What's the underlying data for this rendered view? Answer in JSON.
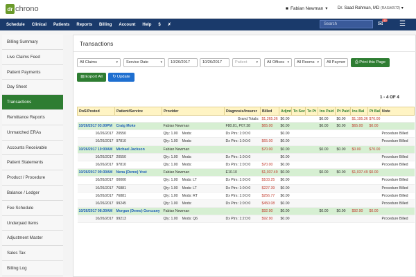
{
  "app": {
    "logo_dr": "dr",
    "logo_name": "chrono"
  },
  "header": {
    "user_name": "Fabian Newman",
    "doctor": "Dr. Saad Rahman, MD",
    "doctor_code": "(RASA6572)"
  },
  "nav": {
    "items": [
      "Schedule",
      "Clinical",
      "Patients",
      "Reports",
      "Billing",
      "Account",
      "Help"
    ],
    "search_placeholder": "Search",
    "mail_badge": "40"
  },
  "sidebar": {
    "items": [
      "Billing Summary",
      "Live Claims Feed",
      "Patient Payments",
      "Day Sheet",
      "Transactions",
      "Remittance Reports",
      "Unmatched ERAs",
      "Accounts Receivable",
      "Patient Statements",
      "Product / Procedure",
      "Balance / Ledger",
      "Fee Schedule",
      "Underpaid Items",
      "Adjustment Master",
      "Sales Tax",
      "Billing Log"
    ],
    "active": "Transactions"
  },
  "main": {
    "title": "Transactions",
    "filters": {
      "claims": "All Claims",
      "date_type": "Service Date",
      "date_from": "10/26/2017",
      "date_to": "10/26/2017",
      "patient_placeholder": "Patient",
      "offices": "All Offices",
      "rooms": "All Rooms",
      "payments": "All Payme"
    },
    "print_label": "Print this Page",
    "export_label": "Export All",
    "update_label": "Update",
    "pager": "1 - 4 OF 4"
  },
  "table": {
    "columns": [
      "DoS/Posted",
      "Patient/Service",
      "Provider",
      "Diagnosis/Insurer",
      "Billed",
      "Adjmt",
      "To Sec",
      "To Pt",
      "Ins Paid",
      "Pt Paid",
      "Ins Bal",
      "Pt Bal",
      "Note"
    ],
    "grand": {
      "label": "Grand Totals:",
      "billed": "$1,265.36",
      "adjmt": "$0.00",
      "ins_paid": "$0.00",
      "pt_paid": "$0.00",
      "ins_bal": "$1,195.36",
      "pt_bal": "$70.00"
    },
    "rows": [
      {
        "type": "patient",
        "date": "10/26/2017 03:00PM",
        "name": "Craig Moke",
        "provider": "Fabian Newman",
        "dx": "F80.81, P07.38",
        "billed": "$65.00",
        "adjmt": "$0.00",
        "ins_paid": "$0.00",
        "pt_paid": "$0.00",
        "ins_bal": "$65.00",
        "pt_bal": "$0.00",
        "note": ""
      },
      {
        "type": "line",
        "date": "10/26/2017",
        "code": "20550",
        "qty": "Qty: 1.00",
        "mods": "Mods:",
        "dx": "Dx Ptrs: 1:0:0:0",
        "billed": "",
        "adjmt": "$0.00",
        "note": "Procedure Billed"
      },
      {
        "type": "line",
        "date": "10/26/2017",
        "code": "97810",
        "qty": "Qty: 1.00",
        "mods": "Mods:",
        "dx": "Dx Ptrs: 1:0:0:0",
        "billed": "$65.00",
        "adjmt": "$0.00",
        "note": "Procedure Billed"
      },
      {
        "type": "patient",
        "date": "10/26/2017 10:00AM",
        "name": "Michael Jackson",
        "provider": "Fabian Newman",
        "dx": "",
        "billed": "$70.00",
        "adjmt": "$0.00",
        "ins_paid": "$0.00",
        "pt_paid": "$0.00",
        "ins_bal": "$0.00",
        "pt_bal": "$70.00",
        "note": ""
      },
      {
        "type": "line",
        "date": "10/26/2017",
        "code": "20550",
        "qty": "Qty: 1.00",
        "mods": "Mods:",
        "dx": "Dx Ptrs: 1:0:0:0",
        "billed": "",
        "adjmt": "$0.00",
        "note": "Procedure Billed"
      },
      {
        "type": "line",
        "date": "10/26/2017",
        "code": "97810",
        "qty": "Qty: 1.00",
        "mods": "Mods:",
        "dx": "Dx Ptrs: 1:0:0:0",
        "billed": "$70.00",
        "adjmt": "$0.00",
        "note": "Procedure Billed"
      },
      {
        "type": "patient",
        "date": "10/26/2017 09:30AM",
        "name": "Nena (Demo) Yost",
        "provider": "Fabian Newman",
        "dx": "E10.10",
        "billed": "$1,037.49",
        "adjmt": "$0.00",
        "ins_paid": "$0.00",
        "pt_paid": "$0.00",
        "ins_bal": "$1,037.49",
        "pt_bal": "$0.00",
        "note": ""
      },
      {
        "type": "line",
        "date": "10/26/2017",
        "code": "00000",
        "qty": "Qty: 1.00",
        "mods": "Mods: LT",
        "dx": "Dx Ptrs: 1:0:0:0",
        "billed": "$103.25",
        "adjmt": "$0.00",
        "note": "Procedure Billed"
      },
      {
        "type": "line",
        "date": "10/26/2017",
        "code": "76881",
        "qty": "Qty: 1.00",
        "mods": "Mods: LT",
        "dx": "Dx Ptrs: 1:0:0:0",
        "billed": "$227.39",
        "adjmt": "$0.00",
        "note": "Procedure Billed"
      },
      {
        "type": "line",
        "date": "10/26/2017",
        "code": "76881",
        "qty": "Qty: 1.00",
        "mods": "Mods: RT",
        "dx": "Dx Ptrs: 1:0:0:0",
        "billed": "$256.77",
        "adjmt": "$0.00",
        "note": "Procedure Billed"
      },
      {
        "type": "line",
        "date": "10/26/2017",
        "code": "99245",
        "qty": "Qty: 1.00",
        "mods": "Mods:",
        "dx": "Dx Ptrs: 1:0:0:0",
        "billed": "$450.08",
        "adjmt": "$0.00",
        "note": "Procedure Billed"
      },
      {
        "type": "patient",
        "date": "10/26/2017 08:30AM",
        "name": "Morgan (Demo) Gorczany",
        "provider": "Fabian Newman",
        "dx": "",
        "billed": "$92.90",
        "adjmt": "$0.00",
        "ins_paid": "$0.00",
        "pt_paid": "$0.00",
        "ins_bal": "$92.90",
        "pt_bal": "$0.00",
        "note": ""
      },
      {
        "type": "line",
        "date": "10/26/2017",
        "code": "99213",
        "qty": "Qty: 1.00",
        "mods": "Mods: Q6",
        "dx": "Dx Ptrs: 1:2:0:0",
        "billed": "$92.90",
        "adjmt": "$0.00",
        "note": "Procedure Billed"
      }
    ]
  }
}
